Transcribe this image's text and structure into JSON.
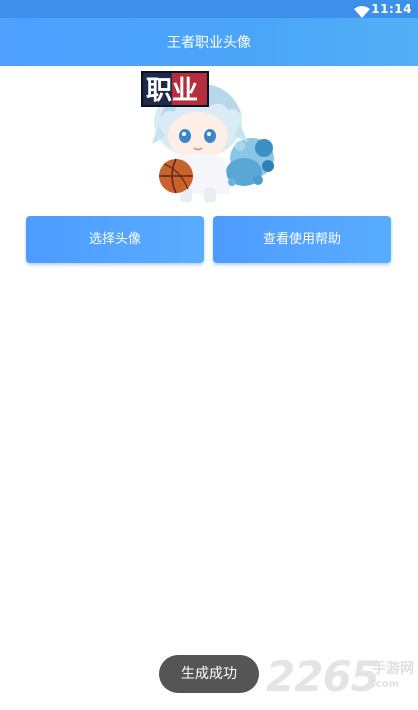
{
  "status_bar": {
    "time": "11:14",
    "icons": [
      "wifi-icon"
    ]
  },
  "app_bar": {
    "title": "王者职业头像"
  },
  "avatar": {
    "badge_text": "职业"
  },
  "buttons": {
    "select_avatar": "选择头像",
    "view_help": "查看使用帮助"
  },
  "toast": {
    "text": "生成成功"
  },
  "watermark": {
    "number": "2265",
    "site_name": "手游网",
    "domain": ".com"
  },
  "colors": {
    "status_bar": "#3d8fea",
    "app_bar": "#4fa0ff",
    "button": "#4d9bff",
    "toast": "#555555"
  }
}
